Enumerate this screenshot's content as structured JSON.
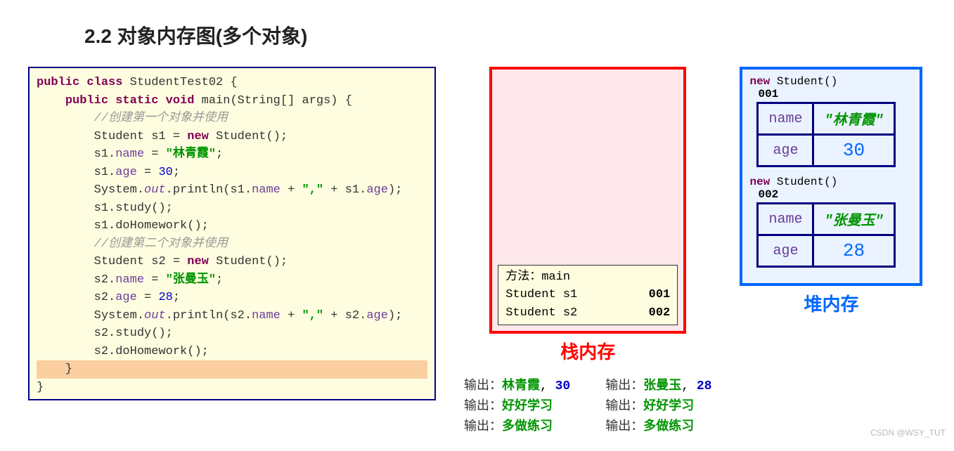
{
  "title": "2.2 对象内存图(多个对象)",
  "code": {
    "class_decl_kw": "public class",
    "class_name": "StudentTest02",
    "main_kw": "public static void",
    "main_sig": "main(String[] args)",
    "comment1": "//创建第一个对象并使用",
    "s1_decl_type": "Student",
    "s1_var": "s1",
    "new_kw": "new",
    "student_ctor": "Student()",
    "s1_name_field": "name",
    "s1_name_val": "\"林青霞\"",
    "s1_age_field": "age",
    "s1_age_val": "30",
    "sys": "System.",
    "out": "out",
    "println": ".println(s1.",
    "sep_str": "\",\"",
    "s1_study": "s1.study();",
    "s1_hw": "s1.doHomework();",
    "comment2": "//创建第二个对象并使用",
    "s2_var": "s2",
    "s2_name_val": "\"张曼玉\"",
    "s2_age_val": "28",
    "s2_study": "s2.study();",
    "s2_hw": "s2.doHomework();",
    "println2_pre": ".println(s2.",
    "age_tail1": " + s1.",
    "age_tail2": " + s2."
  },
  "stack": {
    "label": "栈内存",
    "frame_title": "方法：main",
    "rows": [
      {
        "decl": "Student s1",
        "addr": "001"
      },
      {
        "decl": "Student s2",
        "addr": "002"
      }
    ]
  },
  "heap": {
    "label": "堆内存",
    "objects": [
      {
        "new_text": "new",
        "ctor": "Student()",
        "addr": "001",
        "fields": [
          {
            "key": "name",
            "val": "\"林青霞\"",
            "type": "str"
          },
          {
            "key": "age",
            "val": "30",
            "type": "num"
          }
        ]
      },
      {
        "new_text": "new",
        "ctor": "Student()",
        "addr": "002",
        "fields": [
          {
            "key": "name",
            "val": "\"张曼玉\"",
            "type": "str"
          },
          {
            "key": "age",
            "val": "28",
            "type": "num"
          }
        ]
      }
    ]
  },
  "output": {
    "label": "输出：",
    "col1": [
      {
        "green": "林青霞",
        "sep": ",",
        "blue": "30"
      },
      {
        "green": "好好学习"
      },
      {
        "green": "多做练习"
      }
    ],
    "col2": [
      {
        "green": "张曼玉",
        "sep": ",",
        "blue": "28"
      },
      {
        "green": "好好学习"
      },
      {
        "green": "多做练习"
      }
    ]
  },
  "watermark": "CSDN @WSY_TUT"
}
